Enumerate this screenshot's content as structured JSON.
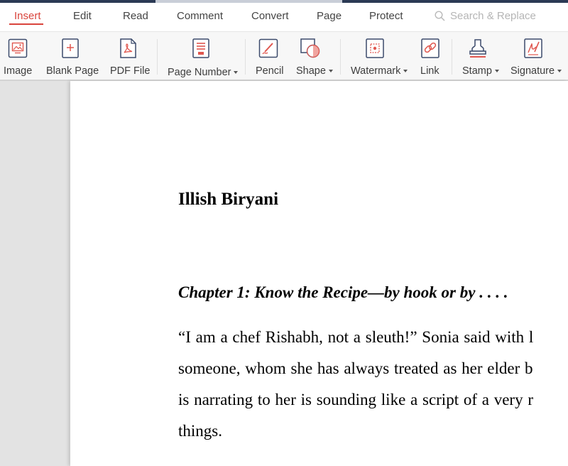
{
  "menu": {
    "tabs": [
      {
        "label": "Insert",
        "active": true
      },
      {
        "label": "Edit"
      },
      {
        "label": "Read"
      },
      {
        "label": "Comment"
      },
      {
        "label": "Convert"
      },
      {
        "label": "Page"
      },
      {
        "label": "Protect"
      }
    ],
    "search_label": "Search & Replace",
    "accent_color": "#d9443c"
  },
  "toolbar": {
    "tools": [
      {
        "label": "Image",
        "icon": "image-icon"
      },
      {
        "label": "Blank Page",
        "icon": "blank-page-icon"
      },
      {
        "label": "PDF File",
        "icon": "pdf-file-icon"
      },
      {
        "label": "Page Number",
        "icon": "page-number-icon",
        "dropdown": true
      },
      {
        "label": "Pencil",
        "icon": "pencil-icon"
      },
      {
        "label": "Shape",
        "icon": "shape-icon",
        "dropdown": true
      },
      {
        "label": "Watermark",
        "icon": "watermark-icon",
        "dropdown": true
      },
      {
        "label": "Link",
        "icon": "link-icon"
      },
      {
        "label": "Stamp",
        "icon": "stamp-icon",
        "dropdown": true
      },
      {
        "label": "Signature",
        "icon": "signature-icon",
        "dropdown": true
      }
    ]
  },
  "document": {
    "title": "Illish Biryani",
    "chapter": "Chapter 1: Know the Recipe—by hook or by . . . .",
    "lines": [
      "“I am a chef Rishabh, not a sleuth!” Sonia said with l",
      "someone, whom she has always treated as her elder b",
      "is narrating to her is sounding like a script of a very r",
      "things."
    ]
  }
}
